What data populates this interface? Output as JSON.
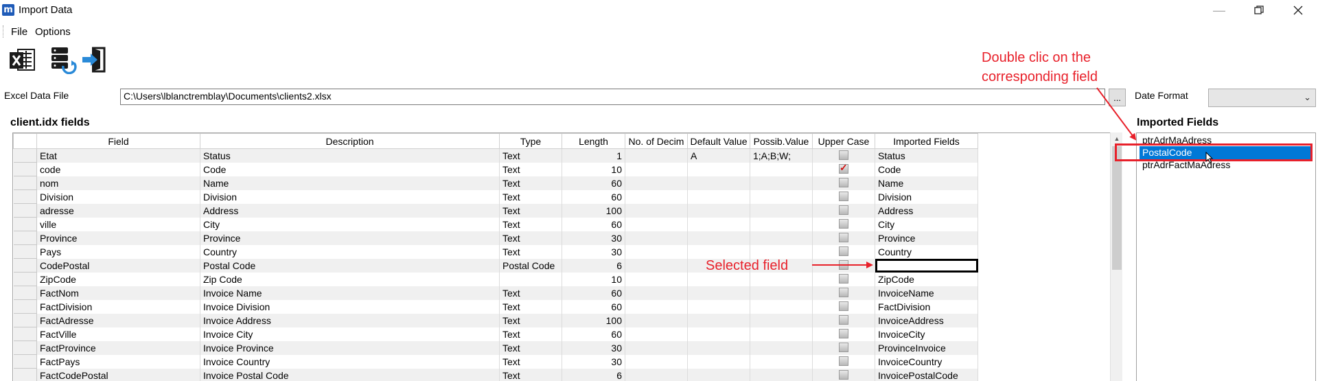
{
  "window": {
    "title": "Import Data",
    "icon_letter": "m"
  },
  "menu": [
    "File",
    "Options"
  ],
  "toolbar": {
    "buttons": [
      "excel-icon",
      "database-refresh-icon",
      "exit-icon"
    ]
  },
  "excel_file": {
    "label": "Excel Data File",
    "value": "C:\\Users\\lblanctremblay\\Documents\\clients2.xlsx",
    "browse_label": "..."
  },
  "date_format": {
    "label": "Date Format",
    "value": ""
  },
  "fields_section": {
    "title": "client.idx fields",
    "columns": [
      "Field",
      "Description",
      "Type",
      "Length",
      "No. of Decim",
      "Default Value",
      "Possib.Value",
      "Upper Case",
      "Imported Fields"
    ],
    "rows": [
      {
        "field": "Etat",
        "description": "Status",
        "type": "Text",
        "length": "1",
        "decimals": "",
        "default": "A",
        "possible": "1;A;B;W;",
        "upper": false,
        "imported": "Status"
      },
      {
        "field": "code",
        "description": "Code",
        "type": "Text",
        "length": "10",
        "decimals": "",
        "default": "",
        "possible": "",
        "upper": true,
        "imported": "Code"
      },
      {
        "field": "nom",
        "description": "Name",
        "type": "Text",
        "length": "60",
        "decimals": "",
        "default": "",
        "possible": "",
        "upper": false,
        "imported": "Name"
      },
      {
        "field": "Division",
        "description": "Division",
        "type": "Text",
        "length": "60",
        "decimals": "",
        "default": "",
        "possible": "",
        "upper": false,
        "imported": "Division"
      },
      {
        "field": "adresse",
        "description": "Address",
        "type": "Text",
        "length": "100",
        "decimals": "",
        "default": "",
        "possible": "",
        "upper": false,
        "imported": "Address"
      },
      {
        "field": "ville",
        "description": "City",
        "type": "Text",
        "length": "60",
        "decimals": "",
        "default": "",
        "possible": "",
        "upper": false,
        "imported": "City"
      },
      {
        "field": "Province",
        "description": "Province",
        "type": "Text",
        "length": "30",
        "decimals": "",
        "default": "",
        "possible": "",
        "upper": false,
        "imported": "Province"
      },
      {
        "field": "Pays",
        "description": "Country",
        "type": "Text",
        "length": "30",
        "decimals": "",
        "default": "",
        "possible": "",
        "upper": false,
        "imported": "Country"
      },
      {
        "field": "CodePostal",
        "description": "Postal Code",
        "type": "Postal Code",
        "length": "6",
        "decimals": "",
        "default": "",
        "possible": "",
        "upper": false,
        "imported": "",
        "selected": true
      },
      {
        "field": "ZipCode",
        "description": "Zip Code",
        "type": "",
        "length": "10",
        "decimals": "",
        "default": "",
        "possible": "",
        "upper": false,
        "imported": "ZipCode"
      },
      {
        "field": "FactNom",
        "description": "Invoice Name",
        "type": "Text",
        "length": "60",
        "decimals": "",
        "default": "",
        "possible": "",
        "upper": false,
        "imported": "InvoiceName"
      },
      {
        "field": "FactDivision",
        "description": "Invoice Division",
        "type": "Text",
        "length": "60",
        "decimals": "",
        "default": "",
        "possible": "",
        "upper": false,
        "imported": "FactDivision"
      },
      {
        "field": "FactAdresse",
        "description": "Invoice Address",
        "type": "Text",
        "length": "100",
        "decimals": "",
        "default": "",
        "possible": "",
        "upper": false,
        "imported": "InvoiceAddress"
      },
      {
        "field": "FactVille",
        "description": "Invoice City",
        "type": "Text",
        "length": "60",
        "decimals": "",
        "default": "",
        "possible": "",
        "upper": false,
        "imported": "InvoiceCity"
      },
      {
        "field": "FactProvince",
        "description": "Invoice Province",
        "type": "Text",
        "length": "30",
        "decimals": "",
        "default": "",
        "possible": "",
        "upper": false,
        "imported": "ProvinceInvoice"
      },
      {
        "field": "FactPays",
        "description": "Invoice Country",
        "type": "Text",
        "length": "30",
        "decimals": "",
        "default": "",
        "possible": "",
        "upper": false,
        "imported": "InvoiceCountry"
      },
      {
        "field": "FactCodePostal",
        "description": "Invoice Postal Code",
        "type": "Text",
        "length": "6",
        "decimals": "",
        "default": "",
        "possible": "",
        "upper": false,
        "imported": "InvoicePostalCode"
      }
    ]
  },
  "imported_section": {
    "title": "Imported Fields",
    "items": [
      "ptrAdrMaAdress",
      "PostalCode",
      "ptrAdrFactMaAdress"
    ],
    "selected_index": 1
  },
  "annotations": {
    "double_click": [
      "Double clic on the",
      "corresponding field"
    ],
    "selected_field": "Selected field",
    "color": "#e8202a"
  },
  "colors": {
    "selection": "#0078d7",
    "alt_row": "#f0f0f0"
  }
}
